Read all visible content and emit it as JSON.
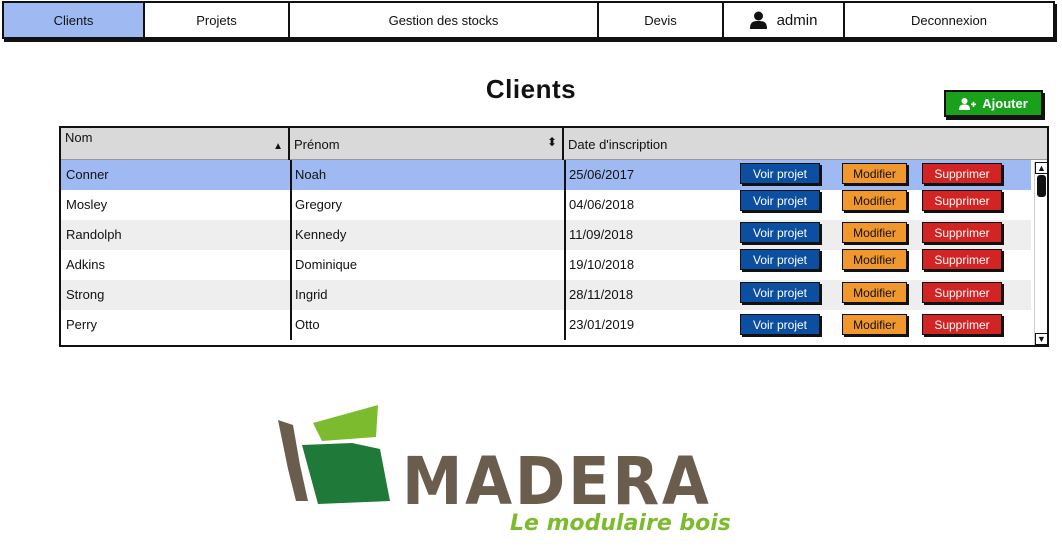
{
  "nav": {
    "items": [
      {
        "label": "Clients",
        "active": true
      },
      {
        "label": "Projets"
      },
      {
        "label": "Gestion des stocks"
      },
      {
        "label": "Devis"
      },
      {
        "label": "admin",
        "icon": "user-icon"
      },
      {
        "label": "Deconnexion"
      }
    ]
  },
  "page": {
    "title": "Clients",
    "add_label": "Ajouter",
    "add_icon": "add-user-icon"
  },
  "table": {
    "columns": [
      "Nom",
      "Prénom",
      "Date d'inscription"
    ],
    "rows": [
      {
        "nom": "Conner",
        "prenom": "Noah",
        "date": "25/06/2017",
        "selected": true
      },
      {
        "nom": "Mosley",
        "prenom": "Gregory",
        "date": "04/06/2018"
      },
      {
        "nom": "Randolph",
        "prenom": "Kennedy",
        "date": "11/09/2018"
      },
      {
        "nom": "Adkins",
        "prenom": "Dominique",
        "date": "19/10/2018"
      },
      {
        "nom": "Strong",
        "prenom": "Ingrid",
        "date": "28/11/2018"
      },
      {
        "nom": "Perry",
        "prenom": "Otto",
        "date": "23/01/2019"
      }
    ],
    "actions": {
      "view_label": "Voir projet",
      "edit_label": "Modifier",
      "delete_label": "Supprimer"
    }
  },
  "colors": {
    "nav_active": "#9fbaf2",
    "add_button": "#19a11c",
    "view_button": "#0c4fa1",
    "edit_button": "#f0972e",
    "delete_button": "#d32424",
    "logo_brown": "#6a5d4d",
    "logo_green_dark": "#1f7a3a",
    "logo_green_light": "#7dbb2e"
  },
  "logo": {
    "word": "MADERA",
    "tagline": "Le modulaire bois"
  }
}
